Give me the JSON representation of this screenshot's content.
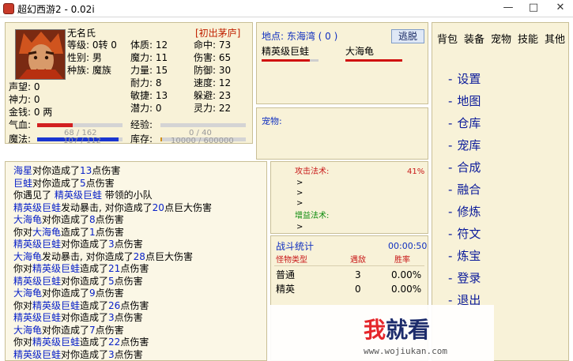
{
  "window": {
    "title": "超幻西游2 - 0.02i",
    "minimize": "—",
    "maximize": "□",
    "close": "✕"
  },
  "character": {
    "name": "无名氏",
    "title": "[初出茅庐]",
    "level": "等级: 0转 0",
    "gender": "性别: 男",
    "race": "种族: 魔族",
    "physique": "体质: 12",
    "magic": "魔力: 11",
    "strength": "力量: 15",
    "endurance": "耐力: 8",
    "agility": "敏捷: 13",
    "potential": "潜力: 0",
    "hit": "命中: 73",
    "damage": "伤害: 65",
    "defense": "防御: 30",
    "speed": "速度: 12",
    "dodge": "躲避: 23",
    "spirit": "灵力: 22",
    "prestige": "声望: 0",
    "divine": "神力: 0",
    "money": "金钱: 0 两",
    "hp_label": "气血:",
    "hp_text": "68 / 162",
    "hp_ratio": 0.42,
    "mp_label": "魔法:",
    "mp_text": "107 / 112",
    "mp_ratio": 0.95,
    "exp_label": "经验:",
    "exp_text": "0 / 40",
    "exp_ratio": 0.0,
    "storage_label": "库存:",
    "storage_text": "10000 / 600000",
    "storage_ratio": 0.02
  },
  "location": {
    "label": "地点: 东海湾 ( 0 )",
    "escape_button": "逃脱",
    "enemies": [
      {
        "name": "精英级巨蛙",
        "hp_ratio": 0.85
      },
      {
        "name": "大海龟",
        "hp_ratio": 1.0
      }
    ]
  },
  "pet": {
    "label": "宠物:"
  },
  "log": [
    [
      {
        "t": "海星",
        "c": "blue"
      },
      {
        "t": "对你造成了"
      },
      {
        "t": "13",
        "c": "blue"
      },
      {
        "t": "点伤害"
      }
    ],
    [
      {
        "t": "巨蛙",
        "c": "blue"
      },
      {
        "t": "对你造成了"
      },
      {
        "t": "5",
        "c": "blue"
      },
      {
        "t": "点伤害"
      }
    ],
    [
      {
        "t": "你遇见了 "
      },
      {
        "t": "精英级巨蛙",
        "c": "blue"
      },
      {
        "t": " 带领的小队"
      }
    ],
    [
      {
        "t": "精英级巨蛙",
        "c": "blue"
      },
      {
        "t": "发动暴击, 对你造成了"
      },
      {
        "t": "20",
        "c": "blue"
      },
      {
        "t": "点巨大伤害"
      }
    ],
    [
      {
        "t": "大海龟",
        "c": "blue"
      },
      {
        "t": "对你造成了"
      },
      {
        "t": "8",
        "c": "blue"
      },
      {
        "t": "点伤害"
      }
    ],
    [
      {
        "t": "你对"
      },
      {
        "t": "大海龟",
        "c": "blue"
      },
      {
        "t": "造成了"
      },
      {
        "t": "1",
        "c": "blue"
      },
      {
        "t": "点伤害"
      }
    ],
    [
      {
        "t": "精英级巨蛙",
        "c": "blue"
      },
      {
        "t": "对你造成了"
      },
      {
        "t": "3",
        "c": "blue"
      },
      {
        "t": "点伤害"
      }
    ],
    [
      {
        "t": "大海龟",
        "c": "blue"
      },
      {
        "t": "发动暴击, 对你造成了"
      },
      {
        "t": "28",
        "c": "blue"
      },
      {
        "t": "点巨大伤害"
      }
    ],
    [
      {
        "t": "你对"
      },
      {
        "t": "精英级巨蛙",
        "c": "blue"
      },
      {
        "t": "造成了"
      },
      {
        "t": "21",
        "c": "blue"
      },
      {
        "t": "点伤害"
      }
    ],
    [
      {
        "t": "精英级巨蛙",
        "c": "blue"
      },
      {
        "t": "对你造成了"
      },
      {
        "t": "5",
        "c": "blue"
      },
      {
        "t": "点伤害"
      }
    ],
    [
      {
        "t": "大海龟",
        "c": "blue"
      },
      {
        "t": "对你造成了"
      },
      {
        "t": "9",
        "c": "blue"
      },
      {
        "t": "点伤害"
      }
    ],
    [
      {
        "t": "你对"
      },
      {
        "t": "精英级巨蛙",
        "c": "blue"
      },
      {
        "t": "造成了"
      },
      {
        "t": "26",
        "c": "blue"
      },
      {
        "t": "点伤害"
      }
    ],
    [
      {
        "t": "精英级巨蛙",
        "c": "blue"
      },
      {
        "t": "对你造成了"
      },
      {
        "t": "3",
        "c": "blue"
      },
      {
        "t": "点伤害"
      }
    ],
    [
      {
        "t": "大海龟",
        "c": "blue"
      },
      {
        "t": "对你造成了"
      },
      {
        "t": "7",
        "c": "blue"
      },
      {
        "t": "点伤害"
      }
    ],
    [
      {
        "t": "你对"
      },
      {
        "t": "精英级巨蛙",
        "c": "blue"
      },
      {
        "t": "造成了"
      },
      {
        "t": "22",
        "c": "blue"
      },
      {
        "t": "点伤害"
      }
    ],
    [
      {
        "t": "精英级巨蛙",
        "c": "blue"
      },
      {
        "t": "对你造成了"
      },
      {
        "t": "3",
        "c": "blue"
      },
      {
        "t": "点伤害"
      }
    ]
  ],
  "spells": {
    "attack_label": "攻击法术:",
    "attack_percent": "41%",
    "attack_items": [
      ">",
      ">",
      ">"
    ],
    "buff_label": "增益法术:",
    "buff_items": [
      ">"
    ]
  },
  "battle_stats": {
    "title": "战斗统计",
    "time": "00:00:50",
    "headers": [
      "怪物类型",
      "遇敌",
      "胜率"
    ],
    "rows": [
      [
        "普通",
        "3",
        "0.00%"
      ],
      [
        "精英",
        "0",
        "0.00%"
      ]
    ]
  },
  "menu": {
    "tabs": [
      "背包",
      "装备",
      "宠物",
      "技能",
      "其他"
    ],
    "items": [
      "设置",
      "地图",
      "仓库",
      "宠库",
      "合成",
      "融合",
      "修炼",
      "符文",
      "炼宝",
      "登录",
      "退出"
    ]
  },
  "watermark": {
    "brand_red": "我",
    "brand_dark": "就看",
    "url": "www.wojiukan.com"
  },
  "colors": {
    "panel_bg": "#f8f2d8",
    "link_blue": "#0a22c8",
    "hp_red": "#d22020",
    "mp_blue": "#1a36d0"
  }
}
